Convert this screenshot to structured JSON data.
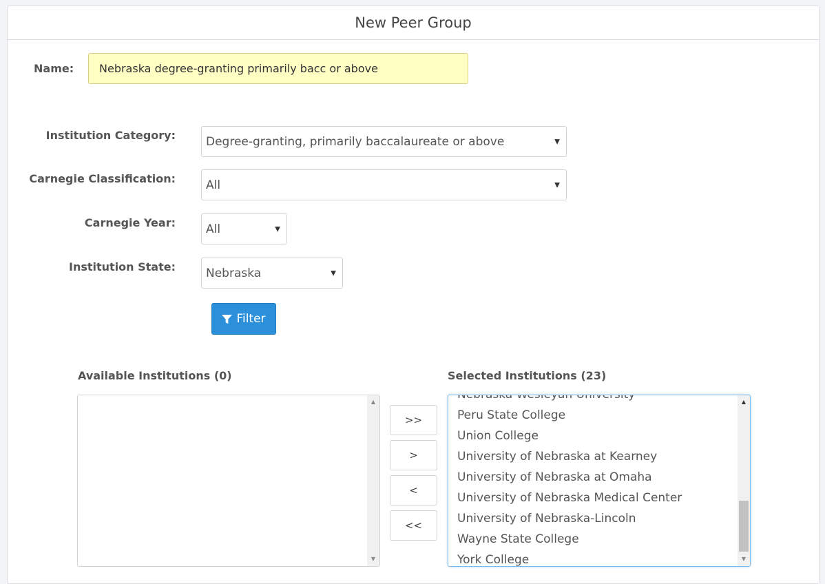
{
  "panel": {
    "title": "New Peer Group"
  },
  "name_field": {
    "label": "Name:",
    "value": "Nebraska degree-granting primarily bacc or above"
  },
  "filters": {
    "institution_category": {
      "label": "Institution Category:",
      "value": "Degree-granting, primarily baccalaureate or above"
    },
    "carnegie_classification": {
      "label": "Carnegie Classification:",
      "value": "All"
    },
    "carnegie_year": {
      "label": "Carnegie Year:",
      "value": "All"
    },
    "institution_state": {
      "label": "Institution State:",
      "value": "Nebraska"
    },
    "filter_button": "Filter"
  },
  "available": {
    "title": "Available Institutions (0)",
    "items": []
  },
  "selected": {
    "title": "Selected Institutions (23)",
    "items": [
      "Nebraska Wesleyan University",
      "Peru State College",
      "Union College",
      "University of Nebraska at Kearney",
      "University of Nebraska at Omaha",
      "University of Nebraska Medical Center",
      "University of Nebraska-Lincoln",
      "Wayne State College",
      "York College"
    ]
  },
  "move_buttons": {
    "add_all": ">>",
    "add": ">",
    "remove": "<",
    "remove_all": "<<"
  },
  "colors": {
    "accent": "#2b90d9",
    "name_bg": "#ffffc4"
  }
}
